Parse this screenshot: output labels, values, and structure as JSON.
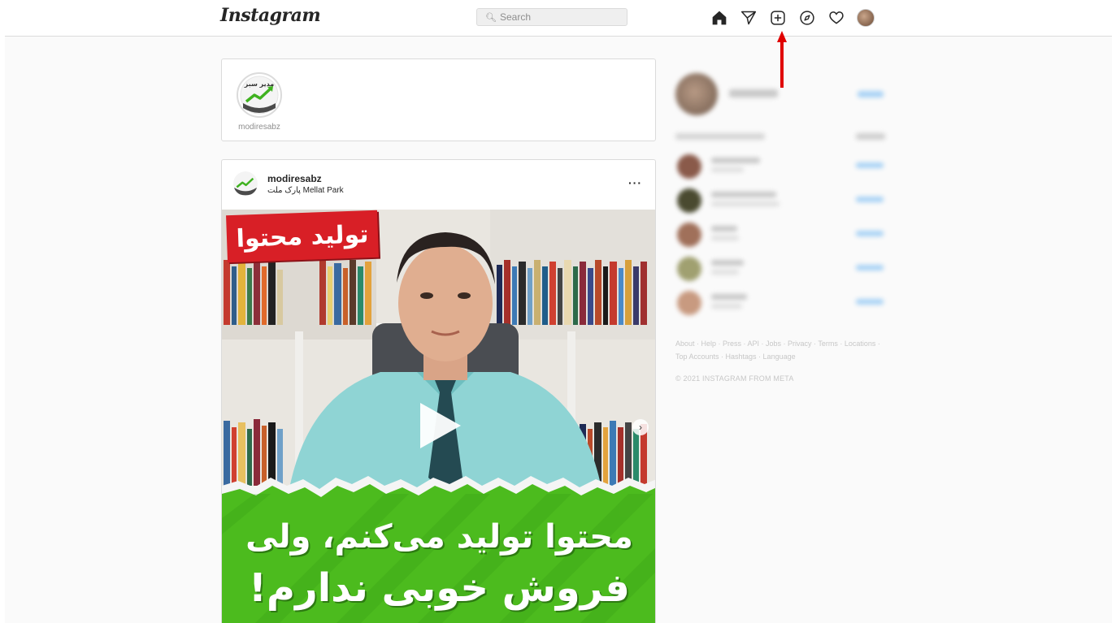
{
  "header": {
    "logo": "Instagram",
    "search_placeholder": "Search",
    "search_icon": "search-icon",
    "nav_icons": [
      "home-icon",
      "direct-message-icon",
      "new-post-icon",
      "explore-icon",
      "activity-heart-icon",
      "profile-avatar"
    ]
  },
  "stories": [
    {
      "username": "modiresabz",
      "logo_text": "مدیر سبز"
    }
  ],
  "post": {
    "username": "modiresabz",
    "location": "پارک ملت Mellat Park",
    "more_label": "···",
    "media": {
      "title_tag": "تولید محتوا",
      "caption_line1": "محتوا تولید می‌کنم، ولی",
      "caption_line2": "فروش خوبی ندارم!",
      "next_label": "›"
    }
  },
  "sidebar": {
    "suggestions_count": 5
  },
  "footer": {
    "links_line1": "About · Help · Press · API · Jobs · Privacy · Terms · Locations ·",
    "links_line2": "Top Accounts · Hashtags · Language",
    "copyright": "© 2021 INSTAGRAM FROM META"
  },
  "colors": {
    "accent_arrow": "#e00000",
    "brand_green": "#3fb21f",
    "tag_red": "#d81f26",
    "link_blue": "#0095f6"
  }
}
